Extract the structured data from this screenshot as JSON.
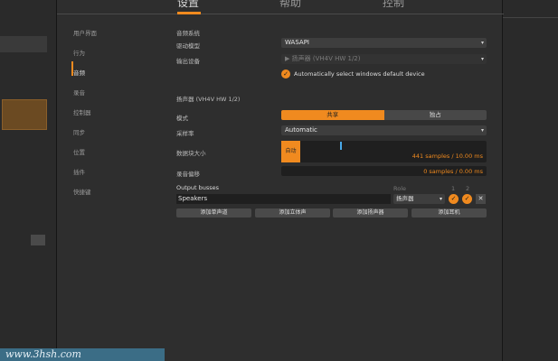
{
  "tabs": [
    {
      "label": "设置"
    },
    {
      "label": "帮助"
    },
    {
      "label": "控制"
    }
  ],
  "nav": {
    "items": [
      {
        "label": "用户界面"
      },
      {
        "label": "行为"
      },
      {
        "label": "音频"
      },
      {
        "label": "录音"
      },
      {
        "label": "控制器"
      },
      {
        "label": "同步"
      },
      {
        "label": "位置"
      },
      {
        "label": "插件"
      },
      {
        "label": "快捷键"
      }
    ]
  },
  "audio_system": {
    "title": "音频系统",
    "driver_label": "驱动模型",
    "driver_value": "WASAPI",
    "output_label": "输出设备",
    "output_value": "扬声器 (VH4V HW 1/2)",
    "auto_select_label": "Automatically select windows default device"
  },
  "device": {
    "title": "扬声器 (VH4V HW 1/2)",
    "mode_label": "模式",
    "mode_options": [
      "共享",
      "独占"
    ],
    "mode_selected": "共享",
    "sample_rate_label": "采样率",
    "sample_rate_value": "Automatic",
    "buffer_label": "数据块大小",
    "buffer_auto": "自动",
    "buffer_value": "441 samples / 10.00 ms",
    "latency_label": "录音偏移",
    "latency_value": "0 samples / 0.00 ms"
  },
  "output_busses": {
    "title": "Output busses",
    "role_header": "Role",
    "channel_headers": [
      "1",
      "2"
    ],
    "rows": [
      {
        "name": "Speakers",
        "role": "扬声器"
      }
    ]
  },
  "buttons": {
    "add_mono": "添加单声道",
    "add_stereo": "添加立体声",
    "add_speakers": "添加扬声器",
    "add_headphones": "添加耳机"
  },
  "watermark": "www.3hsh.com",
  "colors": {
    "accent": "#f08a1f",
    "cursor": "#48a8e8"
  }
}
